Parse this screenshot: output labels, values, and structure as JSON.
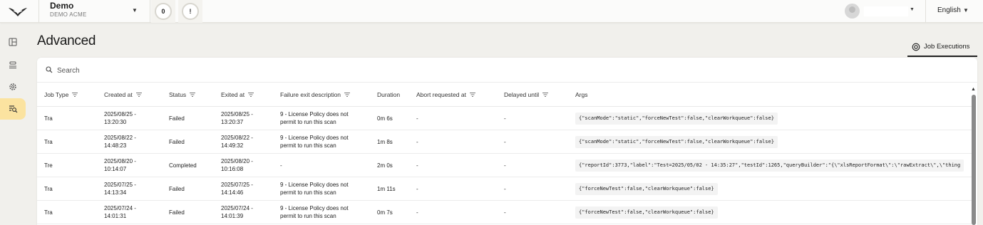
{
  "header": {
    "org_name": "Demo",
    "org_sub": "DEMO ACME",
    "badge_count": "0",
    "alert_label": "!",
    "language": "English"
  },
  "sidebar": {
    "items": [
      {
        "icon": "dashboard-icon"
      },
      {
        "icon": "stack-icon"
      },
      {
        "icon": "gear-icon"
      },
      {
        "icon": "job-search-icon",
        "active": true
      }
    ]
  },
  "page": {
    "title": "Advanced",
    "tab_label": "Job Executions"
  },
  "search": {
    "placeholder": "Search",
    "value": ""
  },
  "table": {
    "columns": [
      "Job Type",
      "Created at",
      "Status",
      "Exited at",
      "Failure exit description",
      "Duration",
      "Abort requested at",
      "Delayed until",
      "Args"
    ],
    "rows": [
      {
        "job_type": "Tra",
        "created_date": "2025/08/25 -",
        "created_time": "13:20:30",
        "status": "Failed",
        "exited_date": "2025/08/25 -",
        "exited_time": "13:20:37",
        "failure_line1": "9 - License Policy does not",
        "failure_line2": "permit to run this scan",
        "duration": "0m 6s",
        "abort": "-",
        "delayed": "-",
        "args": "{\"scanMode\":\"static\",\"forceNewTest\":false,\"clearWorkqueue\":false}"
      },
      {
        "job_type": "Tra",
        "created_date": "2025/08/22 -",
        "created_time": "14:48:23",
        "status": "Failed",
        "exited_date": "2025/08/22 -",
        "exited_time": "14:49:32",
        "failure_line1": "9 - License Policy does not",
        "failure_line2": "permit to run this scan",
        "duration": "1m 8s",
        "abort": "-",
        "delayed": "-",
        "args": "{\"scanMode\":\"static\",\"forceNewTest\":false,\"clearWorkqueue\":false}"
      },
      {
        "job_type": "Tre",
        "created_date": "2025/08/20 -",
        "created_time": "10:14:07",
        "status": "Completed",
        "exited_date": "2025/08/20 -",
        "exited_time": "10:16:08",
        "failure_line1": "-",
        "failure_line2": "",
        "duration": "2m 0s",
        "abort": "-",
        "delayed": "-",
        "args": "{\"reportId\":3773,\"label\":\"Test=2025/05/02 - 14:35:27\",\"testId\":1265,\"queryBuilder\":\"{\\\"xlsReportFormat\\\":\\\"rawExtract\\\",\\\"thing"
      },
      {
        "job_type": "Tra",
        "created_date": "2025/07/25 -",
        "created_time": "14:13:34",
        "status": "Failed",
        "exited_date": "2025/07/25 -",
        "exited_time": "14:14:46",
        "failure_line1": "9 - License Policy does not",
        "failure_line2": "permit to run this scan",
        "duration": "1m 11s",
        "abort": "-",
        "delayed": "-",
        "args": "{\"forceNewTest\":false,\"clearWorkqueue\":false}"
      },
      {
        "job_type": "Tra",
        "created_date": "2025/07/24 -",
        "created_time": "14:01:31",
        "status": "Failed",
        "exited_date": "2025/07/24 -",
        "exited_time": "14:01:39",
        "failure_line1": "9 - License Policy does not",
        "failure_line2": "permit to run this scan",
        "duration": "0m 7s",
        "abort": "-",
        "delayed": "-",
        "args": "{\"forceNewTest\":false,\"clearWorkqueue\":false}"
      }
    ]
  },
  "colors": {
    "accent": "#fbe3a0",
    "background": "#f1f0ec",
    "panel": "#ffffff"
  }
}
